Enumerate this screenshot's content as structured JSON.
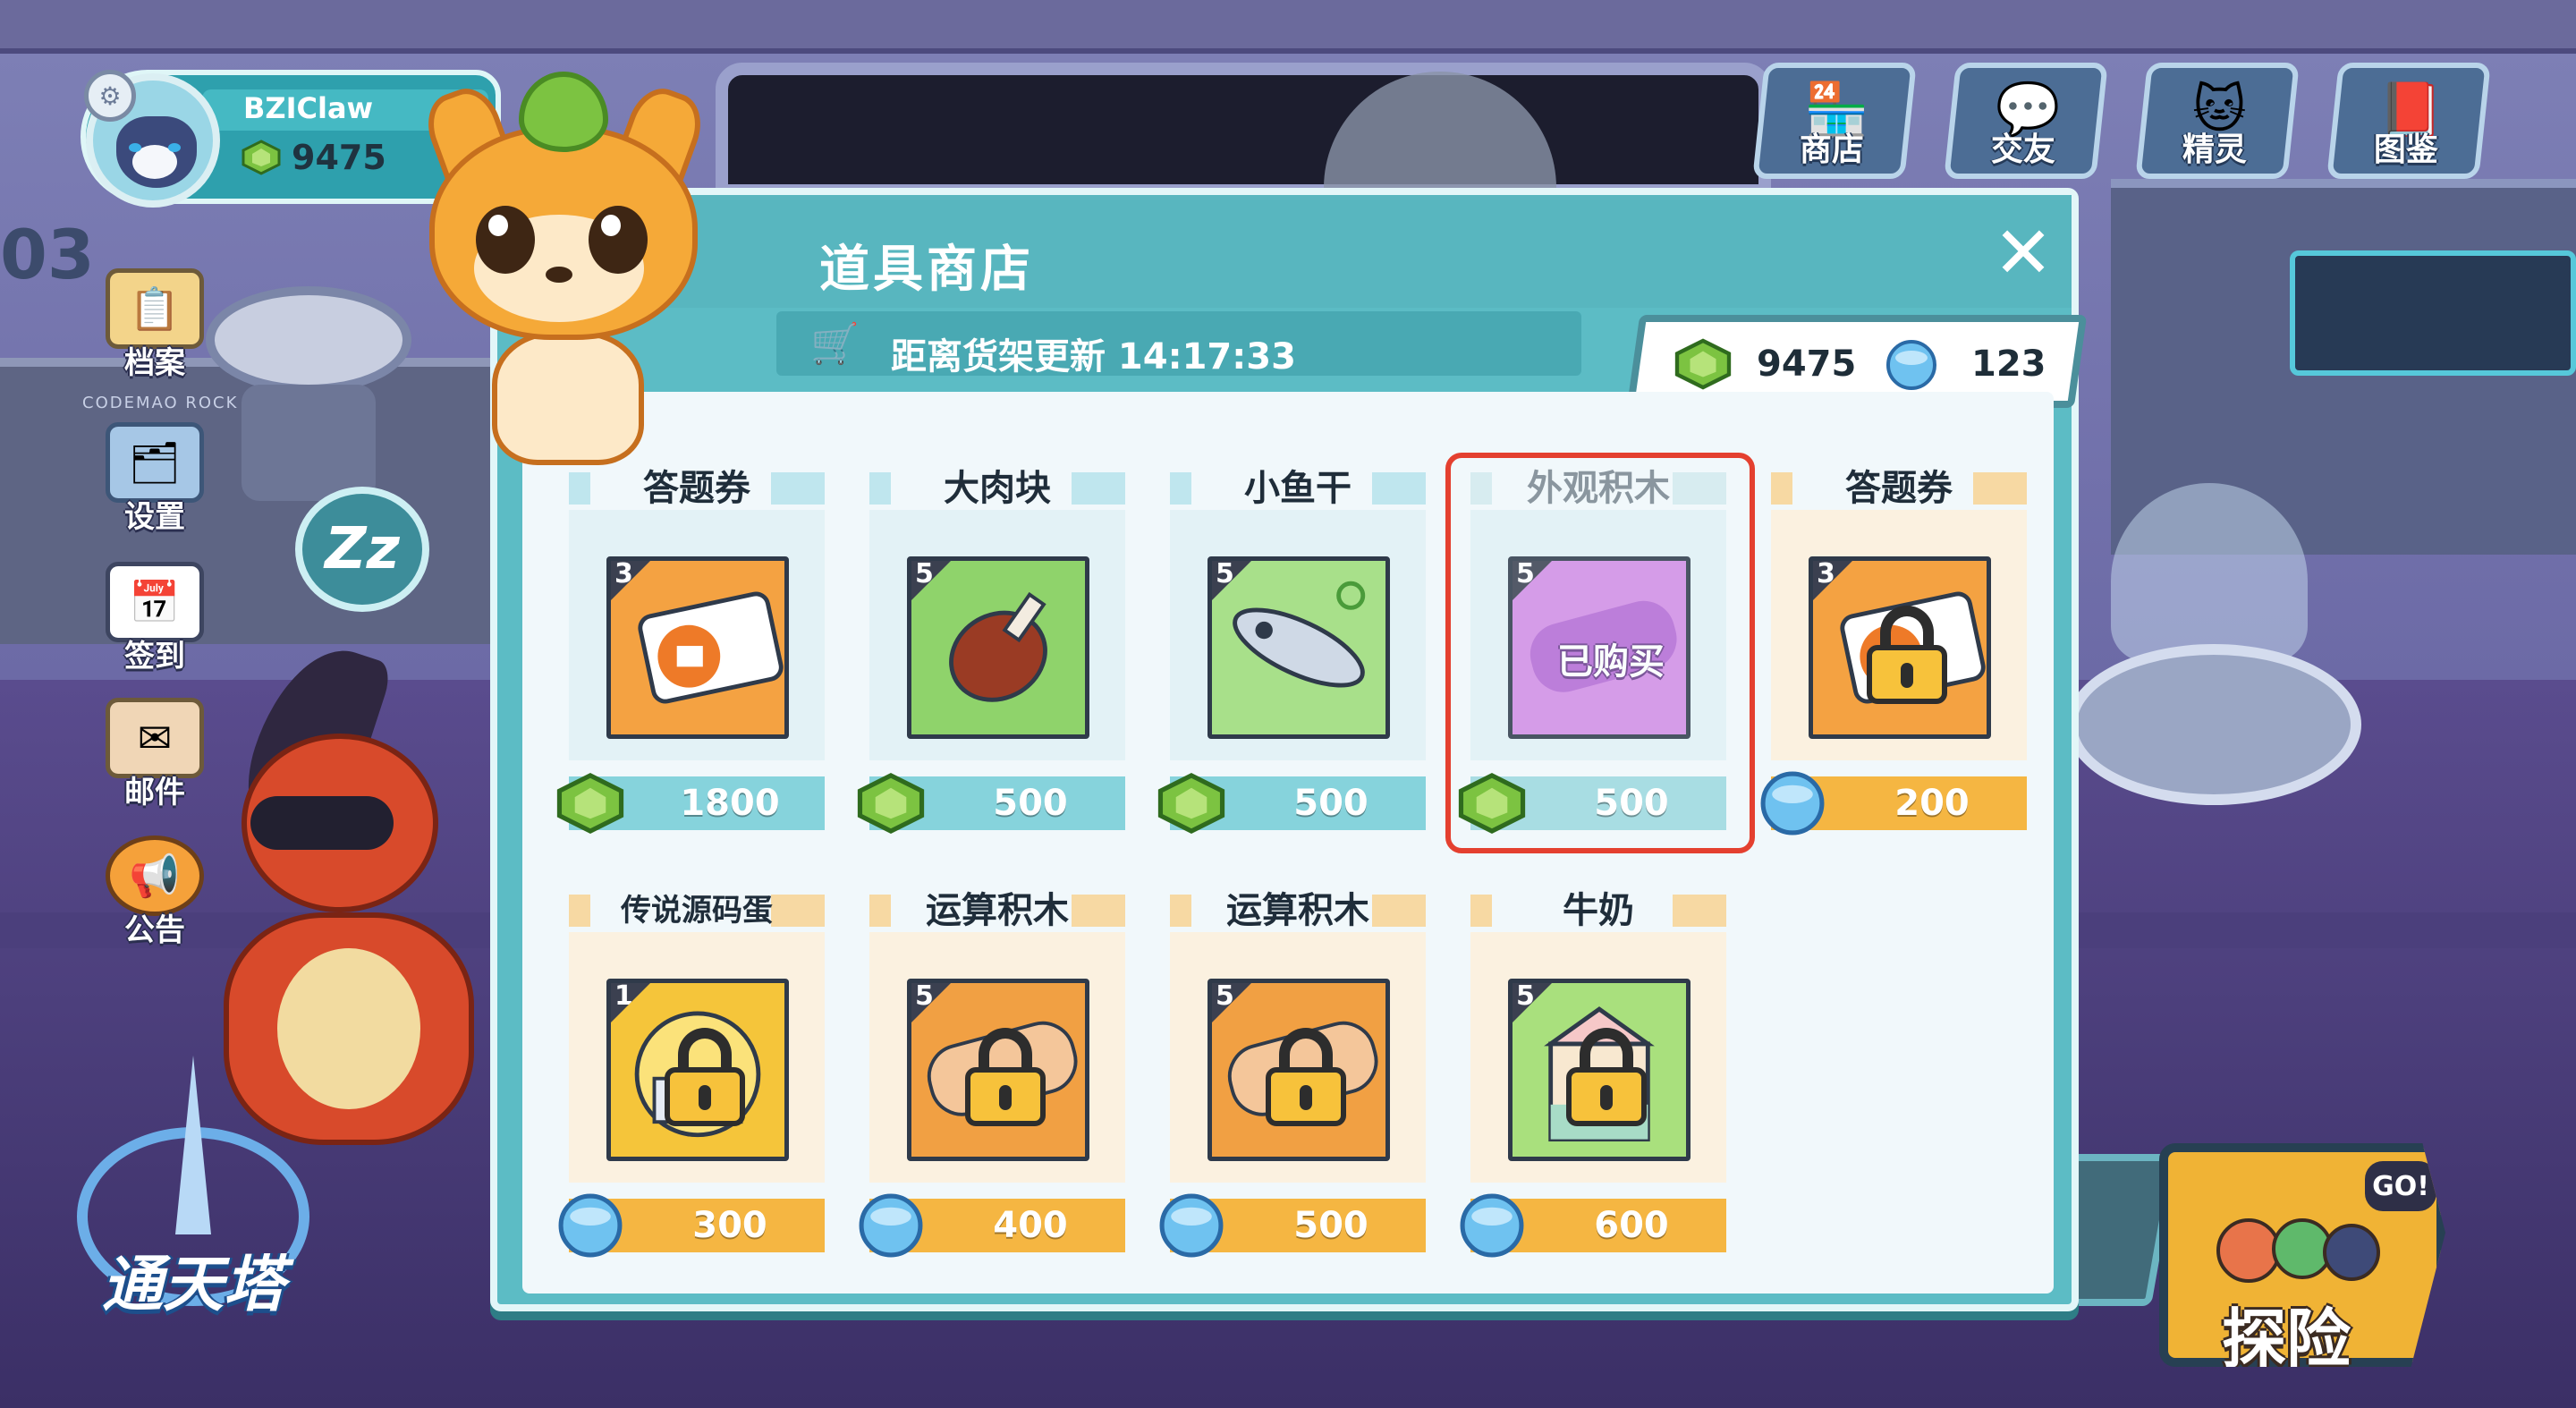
{
  "player": {
    "name": "BZIClaw",
    "coins": "9475"
  },
  "background": {
    "codemao_text": "CODEMAO ROCK",
    "floor_number": "03"
  },
  "side_menu": [
    {
      "label": "档案",
      "icon": "profile-icon"
    },
    {
      "label": "设置",
      "icon": "settings-icon"
    },
    {
      "label": "签到",
      "icon": "calendar-icon"
    },
    {
      "label": "邮件",
      "icon": "mail-icon"
    },
    {
      "label": "公告",
      "icon": "megaphone-icon"
    }
  ],
  "sleep_bubble": "Zz",
  "top_nav": [
    {
      "label": "商店",
      "icon": "shop-icon"
    },
    {
      "label": "交友",
      "icon": "chat-icon"
    },
    {
      "label": "精灵",
      "icon": "pet-icon"
    },
    {
      "label": "图鉴",
      "icon": "book-icon"
    }
  ],
  "tower_logo": "通天塔",
  "explore": {
    "label": "探险",
    "badge": "GO!"
  },
  "shop": {
    "title": "道具商店",
    "refresh_label": "距离货架更新 14:17:33",
    "green_currency": "9475",
    "blue_currency": "123",
    "colors": {
      "green_price_bar": "#86d3dc",
      "gold_price_bar": "#f5b642",
      "highlight": "#e4402f",
      "dialog": "#5cbcc5"
    },
    "items": [
      {
        "name": "答题券",
        "qty": "3",
        "price": "1800",
        "currency": "green",
        "state": "available",
        "icon": "ticket-icon"
      },
      {
        "name": "大肉块",
        "qty": "5",
        "price": "500",
        "currency": "green",
        "state": "available",
        "icon": "meat-icon"
      },
      {
        "name": "小鱼干",
        "qty": "5",
        "price": "500",
        "currency": "green",
        "state": "available",
        "icon": "dried-fish-icon"
      },
      {
        "name": "外观积木",
        "qty": "5",
        "price": "500",
        "currency": "green",
        "state": "owned",
        "owned_label": "已购买",
        "icon": "appearance-block-icon"
      },
      {
        "name": "答题券",
        "qty": "3",
        "price": "200",
        "currency": "blue",
        "state": "locked",
        "icon": "ticket-icon"
      },
      {
        "name": "传说源码蛋",
        "qty": "1",
        "price": "300",
        "currency": "blue",
        "state": "locked",
        "icon": "legend-egg-icon"
      },
      {
        "name": "运算积木",
        "qty": "5",
        "price": "400",
        "currency": "blue",
        "state": "locked",
        "icon": "operator-block-icon"
      },
      {
        "name": "运算积木",
        "qty": "5",
        "price": "500",
        "currency": "blue",
        "state": "locked",
        "icon": "operator-block-icon"
      },
      {
        "name": "牛奶",
        "qty": "5",
        "price": "600",
        "currency": "blue",
        "state": "locked",
        "icon": "milk-icon"
      }
    ]
  }
}
